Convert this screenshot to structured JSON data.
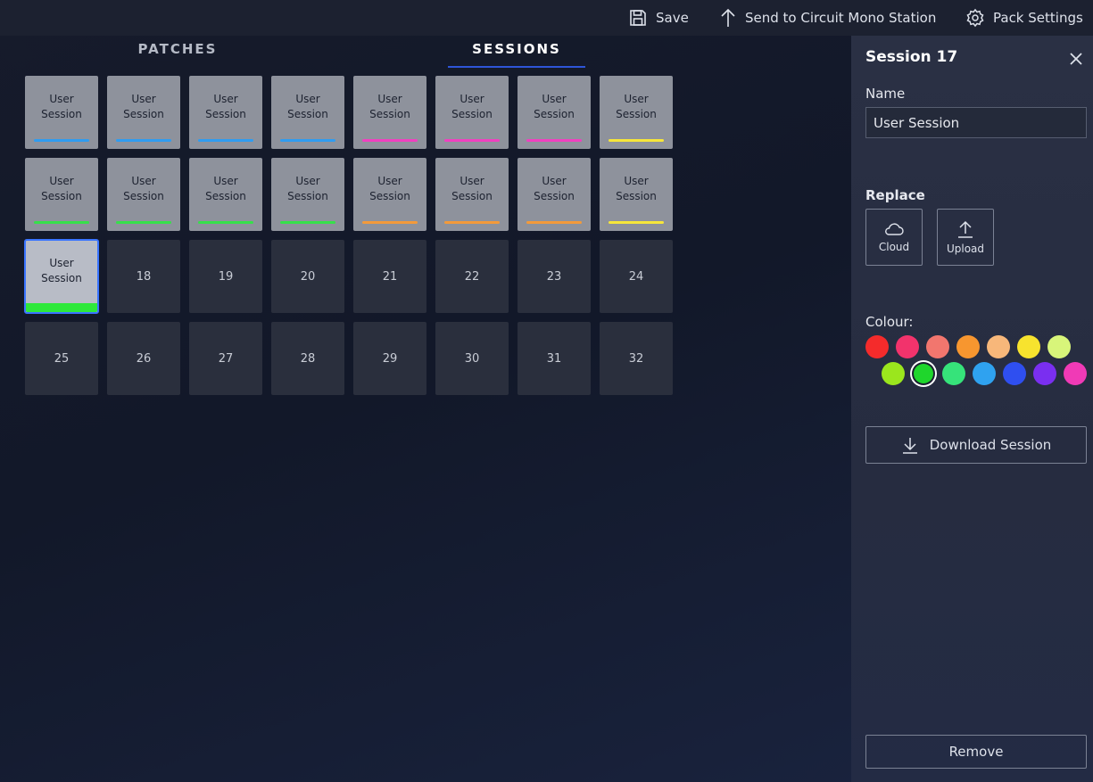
{
  "toolbar": {
    "save_label": "Save",
    "send_label": "Send to Circuit Mono Station",
    "pack_settings_label": "Pack Settings"
  },
  "tabs": [
    {
      "label": "PATCHES",
      "active": false
    },
    {
      "label": "SESSIONS",
      "active": true
    }
  ],
  "slots": [
    {
      "label": "User Session",
      "color": "#2f9cf0"
    },
    {
      "label": "User Session",
      "color": "#2f9cf0"
    },
    {
      "label": "User Session",
      "color": "#2f9cf0"
    },
    {
      "label": "User Session",
      "color": "#2f9cf0"
    },
    {
      "label": "User Session",
      "color": "#f040c0"
    },
    {
      "label": "User Session",
      "color": "#f040c0"
    },
    {
      "label": "User Session",
      "color": "#f040c0"
    },
    {
      "label": "User Session",
      "color": "#f7e63a"
    },
    {
      "label": "User Session",
      "color": "#36e04a"
    },
    {
      "label": "User Session",
      "color": "#36e04a"
    },
    {
      "label": "User Session",
      "color": "#36e04a"
    },
    {
      "label": "User Session",
      "color": "#36e04a"
    },
    {
      "label": "User Session",
      "color": "#f39a3a"
    },
    {
      "label": "User Session",
      "color": "#f39a3a"
    },
    {
      "label": "User Session",
      "color": "#f39a3a"
    },
    {
      "label": "User Session",
      "color": "#f7e63a"
    },
    {
      "label": "User Session",
      "color": "#2ee83a",
      "selected": true
    },
    {
      "label": "18"
    },
    {
      "label": "19"
    },
    {
      "label": "20"
    },
    {
      "label": "21"
    },
    {
      "label": "22"
    },
    {
      "label": "23"
    },
    {
      "label": "24"
    },
    {
      "label": "25"
    },
    {
      "label": "26"
    },
    {
      "label": "27"
    },
    {
      "label": "28"
    },
    {
      "label": "29"
    },
    {
      "label": "30"
    },
    {
      "label": "31"
    },
    {
      "label": "32"
    }
  ],
  "panel": {
    "title": "Session 17",
    "name_label": "Name",
    "name_value": "User Session",
    "replace_label": "Replace",
    "cloud_label": "Cloud",
    "upload_label": "Upload",
    "colour_label": "Colour:",
    "download_label": "Download Session",
    "remove_label": "Remove",
    "swatches": [
      {
        "color": "#f42b2b"
      },
      {
        "color": "#f2336c"
      },
      {
        "color": "#f2766e"
      },
      {
        "color": "#f7962f"
      },
      {
        "color": "#f7b77a"
      },
      {
        "color": "#f7e32e"
      },
      {
        "color": "#d8f57a"
      },
      {
        "color": "#9be61d"
      },
      {
        "color": "#1fd62c",
        "selected": true
      },
      {
        "color": "#36e37a"
      },
      {
        "color": "#2fa2f0"
      },
      {
        "color": "#2f4ff0"
      },
      {
        "color": "#7a2ff0"
      },
      {
        "color": "#f03ab6"
      }
    ]
  }
}
